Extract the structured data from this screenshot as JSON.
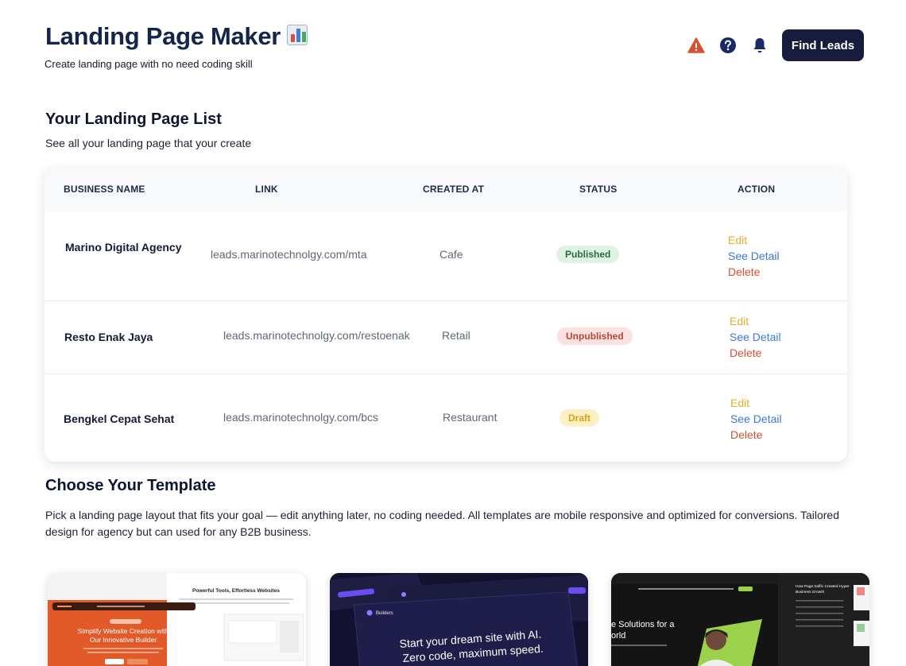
{
  "header": {
    "title": "Landing Page Maker",
    "subtitle": "Create landing page with no need coding skill",
    "find_leads_label": "Find Leads",
    "icons": [
      "warning-icon",
      "help-icon",
      "bell-icon"
    ],
    "colors": {
      "primary": "#161c3b",
      "warning": "#d9502f"
    }
  },
  "list_section": {
    "title": "Your Landing Page List",
    "description": "See all your landing page that your create"
  },
  "table": {
    "columns": [
      "BUSINESS NAME",
      "LINK",
      "CREATED AT",
      "STATUS",
      "ACTION"
    ],
    "rows": [
      {
        "business_name": "Marino Digital Agency",
        "link": "leads.marinotechnolgy.com/mta",
        "created_at": "Cafe",
        "status": "Published",
        "actions": [
          "Edit",
          "See Detail",
          "Delete"
        ]
      },
      {
        "business_name": "Resto Enak Jaya",
        "link": "leads.marinotechnolgy.com/restoenak",
        "created_at": "Retail",
        "status": "Unpublished",
        "actions": [
          "Edit",
          "See Detail",
          "Delete"
        ]
      },
      {
        "business_name": "Bengkel Cepat Sehat",
        "link": "leads.marinotechnolgy.com/bcs",
        "created_at": "Restaurant",
        "status": "Draft",
        "actions": [
          "Edit",
          "See Detail",
          "Delete"
        ]
      }
    ]
  },
  "template_section": {
    "title": "Choose Your Template",
    "description": "Pick a landing page layout that fits your goal — edit anything later, no coding needed. All templates are mobile responsive and optimized for conversions. Tailored design for agency but can used for any B2B business."
  },
  "templates": [
    {
      "hero": "Simplify Website Creation with Our Innovative Builder",
      "side_heading": "Powerful Tools, Effortless Websites",
      "accent": "#e35a2a"
    },
    {
      "hero": "Start your dream site with AI. Zero code, maximum speed.",
      "brand": "Builders",
      "accent": "#6a4df0"
    },
    {
      "hero": "e Solutions for a orld",
      "side_heading": "How Page traffic Created Hyper Business Growth",
      "accent": "#9bd14b"
    }
  ]
}
